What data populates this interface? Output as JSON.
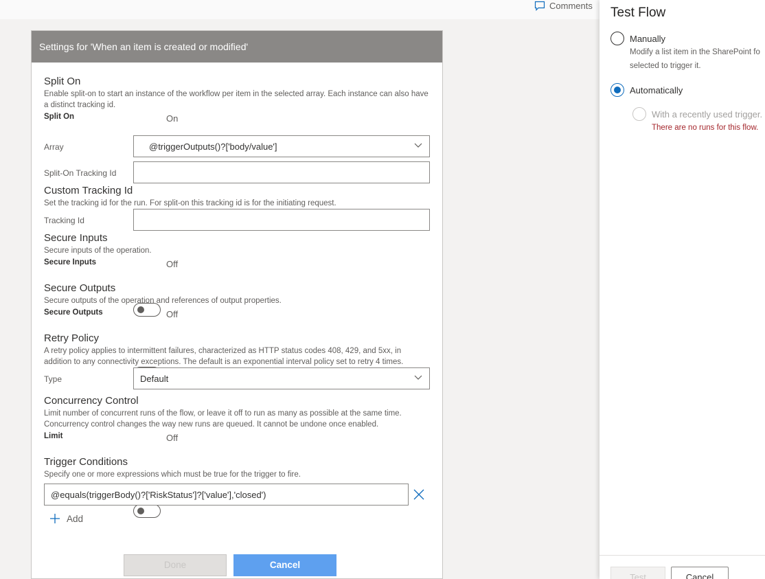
{
  "topbar": {
    "comments_label": "Comments"
  },
  "dialog": {
    "title": "Settings for 'When an item is created or modified'",
    "split_on": {
      "title": "Split On",
      "description": "Enable split-on to start an instance of the workflow per item in the selected array. Each instance can also have a distinct tracking id.",
      "toggle_label": "Split On",
      "toggle_state": "On",
      "array_label": "Array",
      "array_value": "@triggerOutputs()?['body/value']",
      "tracking_label": "Split-On Tracking Id",
      "tracking_value": ""
    },
    "custom_tracking": {
      "title": "Custom Tracking Id",
      "description": "Set the tracking id for the run. For split-on this tracking id is for the initiating request.",
      "field_label": "Tracking Id",
      "field_value": ""
    },
    "secure_inputs": {
      "title": "Secure Inputs",
      "description": "Secure inputs of the operation.",
      "toggle_label": "Secure Inputs",
      "toggle_state": "Off"
    },
    "secure_outputs": {
      "title": "Secure Outputs",
      "description": "Secure outputs of the operation and references of output properties.",
      "toggle_label": "Secure Outputs",
      "toggle_state": "Off"
    },
    "retry_policy": {
      "title": "Retry Policy",
      "description": "A retry policy applies to intermittent failures, characterized as HTTP status codes 408, 429, and 5xx, in addition to any connectivity exceptions. The default is an exponential interval policy set to retry 4 times.",
      "type_label": "Type",
      "type_value": "Default"
    },
    "concurrency": {
      "title": "Concurrency Control",
      "description": "Limit number of concurrent runs of the flow, or leave it off to run as many as possible at the same time. Concurrency control changes the way new runs are queued. It cannot be undone once enabled.",
      "toggle_label": "Limit",
      "toggle_state": "Off"
    },
    "trigger_conditions": {
      "title": "Trigger Conditions",
      "description": "Specify one or more expressions which must be true for the trigger to fire.",
      "condition_value": "@equals(triggerBody()?['RiskStatus']?['value'],'closed')",
      "add_label": "Add"
    },
    "buttons": {
      "done": "Done",
      "cancel": "Cancel"
    }
  },
  "test_flow": {
    "title": "Test Flow",
    "manually_label": "Manually",
    "manually_desc_line1": "Modify a list item in the SharePoint fo",
    "manually_desc_line2": "selected to trigger it.",
    "automatically_label": "Automatically",
    "recent_trigger_label": "With a recently used trigger.",
    "no_runs_message": "There are no runs for this flow.",
    "test_button": "Test",
    "cancel_button": "Cancel"
  },
  "colors": {
    "accent": "#0f6cbd",
    "toggle_on": "#4a8fe0",
    "error": "#a4262c",
    "header": "#8a8886"
  }
}
